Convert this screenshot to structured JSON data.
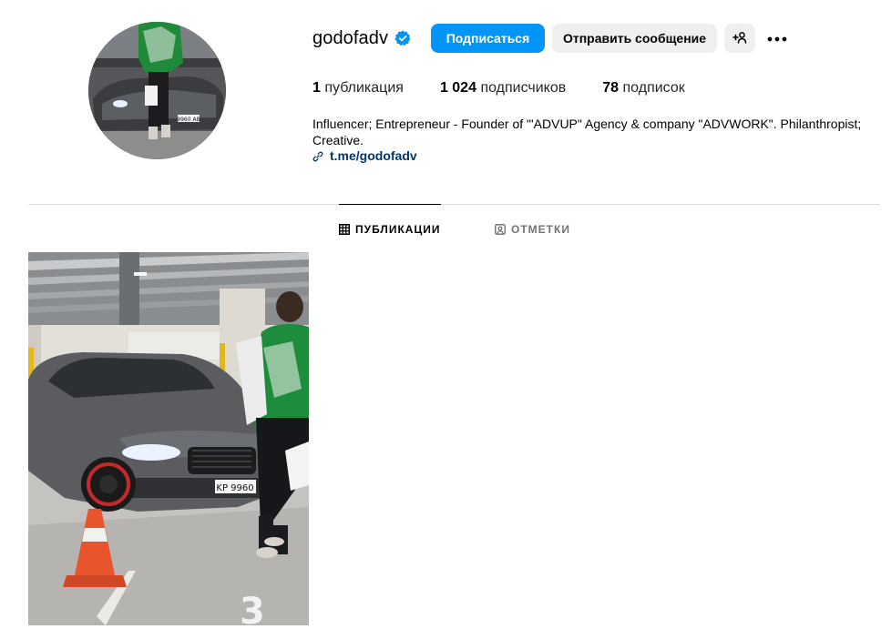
{
  "profile": {
    "username": "godofadv",
    "verified": true,
    "follow_label": "Подписаться",
    "message_label": "Отправить сообщение",
    "stats": [
      {
        "count": "1",
        "label": "публикация"
      },
      {
        "count": "1 024",
        "label": "подписчиков"
      },
      {
        "count": "78",
        "label": "подписок"
      }
    ],
    "bio": "Influencer; Entrepreneur - Founder of \"'ADVUP\" Agency & company \"ADVWORK\". Philanthropist; Creative.",
    "link": "t.me/godofadv"
  },
  "avatar_plate": "9960 AB",
  "tabs": {
    "posts": "ПУБЛИКАЦИИ",
    "tagged": "ОТМЕТКИ"
  },
  "post": {
    "plate": "KP 9960"
  },
  "icons": {
    "verified": "verified-badge-icon",
    "add_user": "add-user-icon",
    "more": "more-options-icon",
    "link": "link-icon",
    "grid": "grid-icon",
    "tagged": "tagged-icon"
  },
  "colors": {
    "accent": "#0095f6",
    "button_secondary": "#efefef",
    "link": "#00376b",
    "divider": "#dbdbdb",
    "muted": "#737373"
  }
}
